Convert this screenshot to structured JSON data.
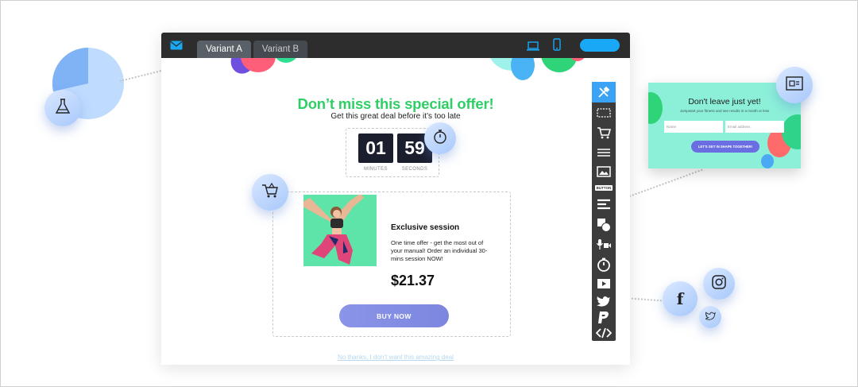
{
  "tabs": [
    {
      "label": "Variant A",
      "active": true
    },
    {
      "label": "Variant B",
      "active": false
    }
  ],
  "view_icons": [
    "desktop-icon",
    "mobile-icon"
  ],
  "offer": {
    "headline": "Don’t miss this special offer!",
    "subheadline": "Get this great deal before it’s too late",
    "timer": {
      "minutes": "01",
      "seconds": "59",
      "minutes_label": "MINUTES",
      "seconds_label": "SECONDS"
    },
    "product": {
      "title": "Exclusive session",
      "description": "One time offer - get the most out of your manual! Order an individual 30-mins session NOW!",
      "price": "$21.37"
    },
    "buy_label": "BUY NOW",
    "decline_label": "No thanks, I don’t want this amazing deal"
  },
  "toolbar": {
    "tools": [
      "tools-icon",
      "select-icon",
      "cart-icon",
      "text-icon",
      "image-icon",
      "button-tool",
      "form-icon",
      "shapes-icon",
      "media-icon",
      "timer-icon",
      "video-icon",
      "twitter-icon",
      "paypal-icon",
      "code-icon"
    ],
    "button_tool_label": "BUTTON"
  },
  "popup": {
    "title": "Don't leave just yet!",
    "subtitle": "Jumpstart your fitness and see results in a month or less",
    "name_placeholder": "Name",
    "email_placeholder": "Email address",
    "cta_label": "LET'S GET IN SHAPE TOGETHER!"
  },
  "bubbles": [
    "flask-icon",
    "stopwatch-icon",
    "basket-icon",
    "popup-icon",
    "facebook-icon",
    "instagram-icon",
    "twitter-icon"
  ],
  "colors": {
    "accent_green": "#2fcf66",
    "accent_blue": "#19a8f5",
    "topbar": "#2d2d2d",
    "toolbar_active": "#3aa3f5",
    "button_gradient": "#8a95e8",
    "popup_bg": "#8cf0d9"
  }
}
